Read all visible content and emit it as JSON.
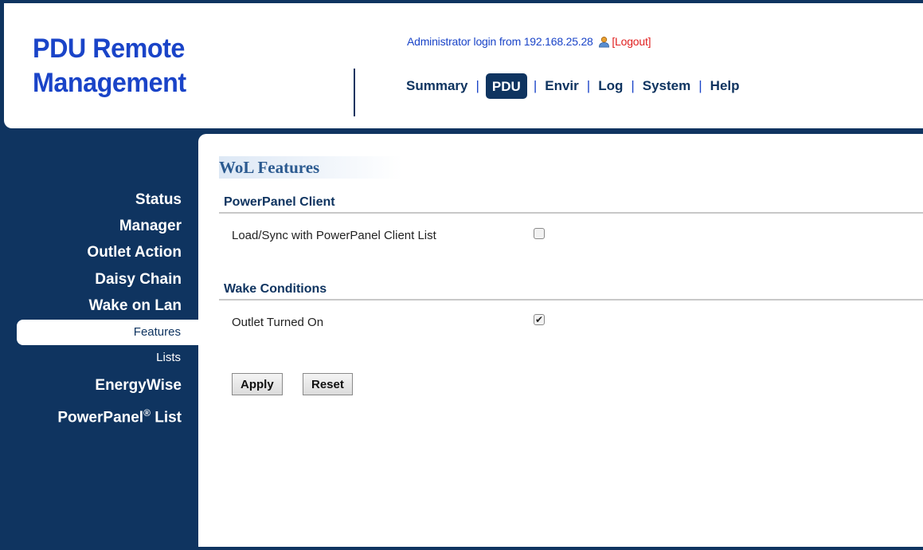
{
  "header": {
    "logo_line1": "PDU Remote",
    "logo_line2": "Management",
    "login_text": "Administrator login from 192.168.25.28",
    "logout_label": "[Logout]"
  },
  "topnav": {
    "items": [
      {
        "label": "Summary",
        "active": false
      },
      {
        "label": "PDU",
        "active": true
      },
      {
        "label": "Envir",
        "active": false
      },
      {
        "label": "Log",
        "active": false
      },
      {
        "label": "System",
        "active": false
      },
      {
        "label": "Help",
        "active": false
      }
    ],
    "separator": "|"
  },
  "sidebar": {
    "status": "Status",
    "manager": "Manager",
    "outlet_action": "Outlet Action",
    "daisy_chain": "Daisy Chain",
    "wake_on_lan": "Wake on Lan",
    "features": "Features",
    "lists": "Lists",
    "energywise": "EnergyWise",
    "powerpanel_list_prefix": "PowerPanel",
    "powerpanel_list_reg": "®",
    "powerpanel_list_suffix": " List"
  },
  "main": {
    "page_title": "WoL Features",
    "section1_title": "PowerPanel Client",
    "load_sync_label": "Load/Sync with PowerPanel Client List",
    "load_sync_checked": false,
    "section2_title": "Wake Conditions",
    "outlet_on_label": "Outlet Turned On",
    "outlet_on_checked": true,
    "apply_label": "Apply",
    "reset_label": "Reset"
  },
  "colors": {
    "navy": "#0f3460",
    "logo_blue": "#1a44c8",
    "logout_red": "#e02020"
  }
}
